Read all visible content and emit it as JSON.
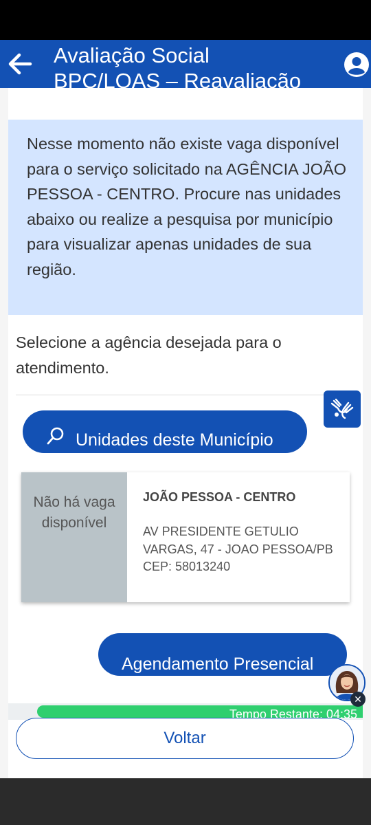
{
  "header": {
    "title": "Avaliação Social\nBPC/LOAS – Reavaliação"
  },
  "info_message": "Nesse momento não existe vaga disponível para o serviço solicitado na AGÊNCIA JOÃO PESSOA - CENTRO. Procure nas unidades abaixo ou realize a pesquisa por município para visualizar apenas unidades de sua região.",
  "instruction": "Selecione a agência desejada para o atendimento.",
  "municipio_button": {
    "label": "Unidades deste Município",
    "icon": "search-icon"
  },
  "agency": {
    "status": "Não há vaga disponível",
    "name": "JOÃO PESSOA - CENTRO",
    "address": "AV PRESIDENTE GETULIO VARGAS, 47 - JOAO PESSOA/PB",
    "cep": "CEP: 58013240"
  },
  "presencial_button": {
    "label": "Agendamento Presencial"
  },
  "timer": {
    "label": "Tempo Restante: 04:35",
    "progress": 0.92
  },
  "voltar_button": {
    "label": "Voltar"
  },
  "colors": {
    "primary": "#1351b4",
    "info_bg": "#d4e5ff",
    "timer": "#2fcf6f",
    "status_bg": "#b9c3c8"
  }
}
